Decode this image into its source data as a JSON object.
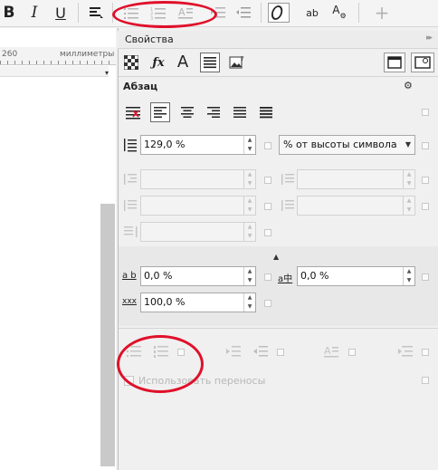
{
  "toolbar": {
    "bold_label": "B",
    "italic_label": "I",
    "underline_label": "U",
    "ab_label": "ab",
    "char_label": "A",
    "add_label": "+"
  },
  "ruler": {
    "tick_label": "260",
    "units_label": "миллиметры"
  },
  "panel": {
    "title": "Свойства",
    "collapse_glyph": "▸▸",
    "section_title": "Абзац",
    "line_spacing_value": "129,0 %",
    "line_spacing_unit": "% от высоты символа",
    "char_spacing_value": "0,0 %",
    "lang_spacing_value": "0,0 %",
    "word_spacing_value": "100,0 %",
    "hyphenation_label": "Использовать переносы",
    "label_ab": "a b",
    "label_xxx": "xxx",
    "label_ai": "a中"
  },
  "colors": {
    "annotation": "#e0102a",
    "accent": "#1e1e1e"
  }
}
